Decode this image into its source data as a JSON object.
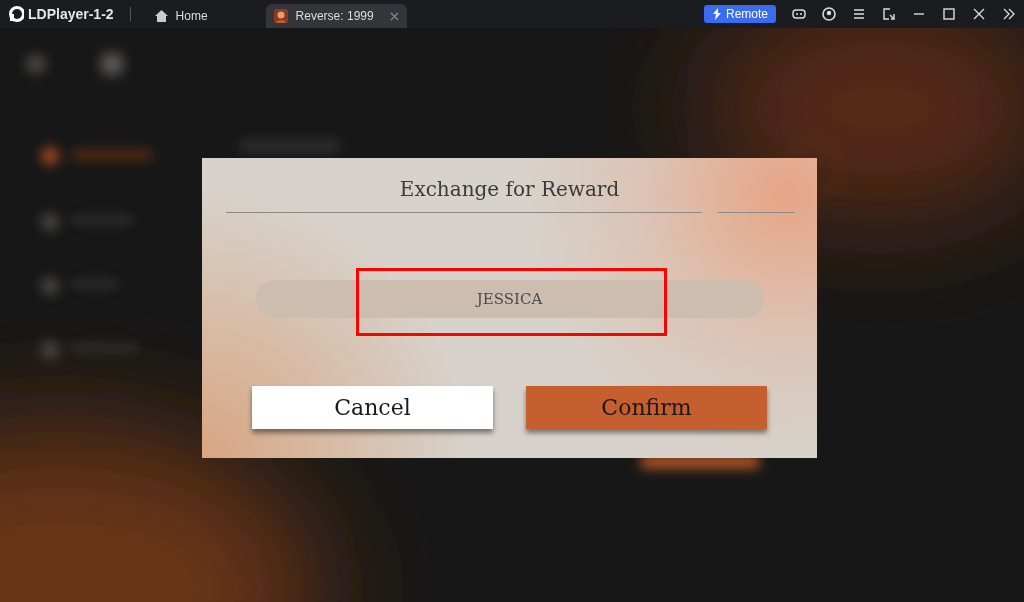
{
  "app": {
    "title": "LDPlayer-1-2"
  },
  "tabs": [
    {
      "label": "Home",
      "kind": "home",
      "selected": false
    },
    {
      "label": "Reverse: 1999",
      "kind": "game",
      "selected": true
    }
  ],
  "remote_button": {
    "label": "Remote"
  },
  "dialog": {
    "title": "Exchange for Reward",
    "field": {
      "value": "JESSICA",
      "highlighted": true
    },
    "buttons": [
      {
        "label": "Cancel",
        "kind": "secondary"
      },
      {
        "label": "Confirm",
        "kind": "primary"
      }
    ]
  }
}
